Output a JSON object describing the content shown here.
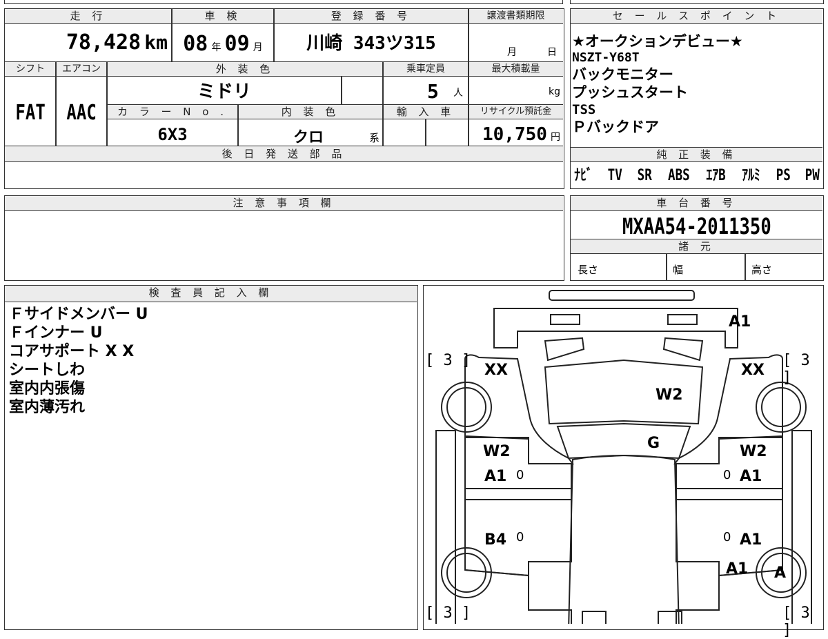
{
  "header": {
    "mileage_label": "走 行",
    "mileage_value": "78,428",
    "mileage_unit": "km",
    "inspection_label": "車 検",
    "inspection_year": "08",
    "inspection_year_unit": "年",
    "inspection_month": "09",
    "inspection_month_unit": "月",
    "registration_label": "登 録 番 号",
    "registration_value": "川崎 343ツ315",
    "transfer_label": "譲渡書類期限",
    "transfer_month": "月",
    "transfer_day": "日"
  },
  "row2": {
    "shift_label": "シフト",
    "shift_value": "FAT",
    "ac_label": "エアコン",
    "ac_value": "AAC",
    "exterior_label": "外 装 色",
    "exterior_value": "ミドリ",
    "capacity_label": "乗車定員",
    "capacity_value": "5",
    "capacity_unit": "人",
    "maxload_label": "最大積載量",
    "maxload_unit": "kg",
    "colorno_label": "カ ラ ー N o .",
    "colorno_value": "6X3",
    "interior_label": "内 装 色",
    "interior_value": "クロ",
    "interior_suffix": "系",
    "import_label": "輸 入 車",
    "recycle_label": "リサイクル預託金",
    "recycle_value": "10,750",
    "recycle_unit": "円"
  },
  "parts": {
    "label": "後 日 発 送 部 品"
  },
  "notes": {
    "label": "注 意 事 項 欄"
  },
  "sales": {
    "label": "セ ー ル ス ポ イ ン ト",
    "lines": [
      "★オークションデビュー★",
      "NSZT-Y68T",
      "バックモニター",
      "プッシュスタート",
      "TSS",
      "Ｐバックドア"
    ]
  },
  "equipment": {
    "label": "純 正 装 備",
    "items": [
      "ﾅﾋﾞ",
      "TV",
      "SR",
      "ABS",
      "ｴｱB",
      "ｱﾙﾐ",
      "PS",
      "PW"
    ]
  },
  "chassis": {
    "label": "車 台 番 号",
    "value": "MXAA54-2011350",
    "spec_label": "諸 元",
    "length_label": "長さ",
    "width_label": "幅",
    "height_label": "高さ"
  },
  "inspector": {
    "label": "検 査 員 記 入 欄",
    "lines": [
      "Ｆサイドメンバー U",
      "Ｆインナー U",
      "コアサポート X X",
      "シートしわ",
      "室内内張傷",
      "室内薄汚れ"
    ]
  },
  "diagram": {
    "marks": {
      "roof_front_right": "A1",
      "front_left": "XX",
      "front_right": "XX",
      "hood": "W2",
      "glass": "G",
      "door_fl_1": "W2",
      "door_fl_2": "A1",
      "door_fr_1": "W2",
      "door_fr_2": "A1",
      "door_rl": "B4",
      "door_rr": "A1",
      "rear_right": "A1",
      "rear_wheel_right": "A",
      "zero": "0"
    },
    "tire_brackets": {
      "front_left": "[ 3 ]",
      "front_right": "[ 3 ]",
      "rear_left": "[ 3 ]",
      "rear_right": "[ 3 ]"
    }
  }
}
